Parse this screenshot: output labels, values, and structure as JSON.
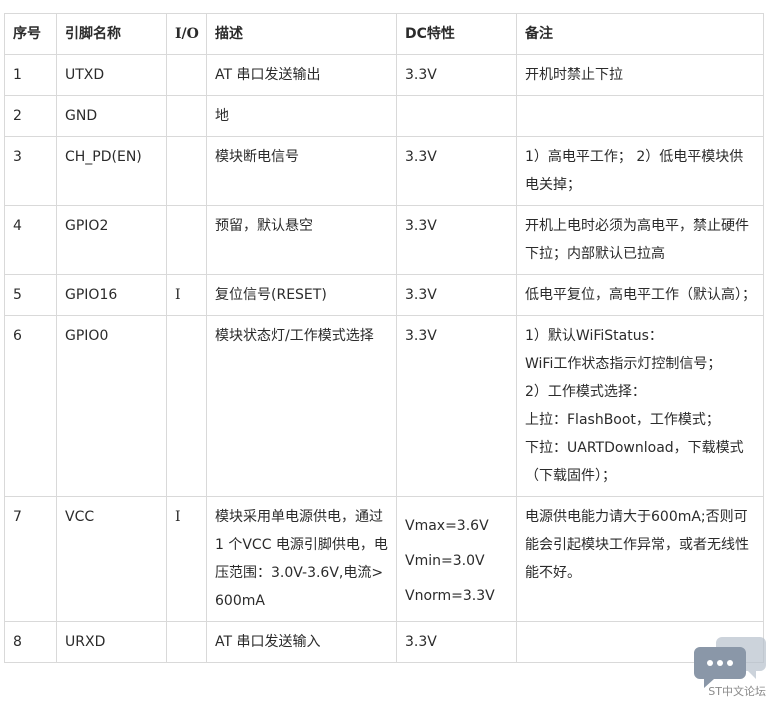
{
  "header": [
    "序号",
    "引脚名称",
    "I/O",
    "描述",
    "DC特性",
    "备注"
  ],
  "rows": [
    {
      "no": "1",
      "pin": "UTXD",
      "io": "",
      "desc": [
        "AT 串口发送输出"
      ],
      "dc": [
        "3.3V"
      ],
      "note": [
        "开机时禁止下拉"
      ]
    },
    {
      "no": "2",
      "pin": "GND",
      "io": "",
      "desc": [
        "地"
      ],
      "dc": [
        ""
      ],
      "note": [
        ""
      ]
    },
    {
      "no": "3",
      "pin": "CH_PD(EN)",
      "io": "",
      "desc": [
        "模块断电信号"
      ],
      "dc": [
        "3.3V"
      ],
      "note": [
        " 1）高电平工作； 2）低电平模块供电关掉；"
      ]
    },
    {
      "no": "4",
      "pin": "GPIO2",
      "io": "",
      "desc": [
        "预留，默认悬空"
      ],
      "dc": [
        "3.3V"
      ],
      "note": [
        "开机上电时必须为高电平，禁止硬件下拉；内部默认已拉高"
      ]
    },
    {
      "no": "5",
      "pin": "GPIO16",
      "io": "I",
      "desc": [
        "复位信号(RESET)"
      ],
      "dc": [
        "3.3V"
      ],
      "note": [
        "低电平复位，高电平工作（默认高）；"
      ]
    },
    {
      "no": "6",
      "pin": "GPIO0",
      "io": "",
      "desc": [
        "模块状态灯/工作模式选择"
      ],
      "dc": [
        "3.3V"
      ],
      "note": [
        "1）默认WiFiStatus：",
        "WiFi工作状态指示灯控制信号；",
        "2）工作模式选择：",
        "上拉：FlashBoot，工作模式；",
        "下拉：UARTDownload，下载模式（下载固件）；"
      ]
    },
    {
      "no": "7",
      "pin": "VCC",
      "io": "I",
      "desc": [
        "模块采用单电源供电，通过 1 个VCC 电源引脚供电，电压范围：3.0V-3.6V,电流>600mA"
      ],
      "dc": [
        "Vmax=3.6V",
        "Vmin=3.0V",
        "Vnorm=3.3V"
      ],
      "note": [
        "电源供电能力请大于600mA;否则可能会引起模块工作异常，或者无线性能不好。"
      ]
    },
    {
      "no": "8",
      "pin": "URXD",
      "io": "",
      "desc": [
        "AT 串口发送输入"
      ],
      "dc": [
        "3.3V"
      ],
      "note": [
        ""
      ]
    }
  ],
  "watermark": {
    "text": "ST中文论坛",
    "icon": "chat-bubble-icon",
    "color": "#8a97a8"
  }
}
